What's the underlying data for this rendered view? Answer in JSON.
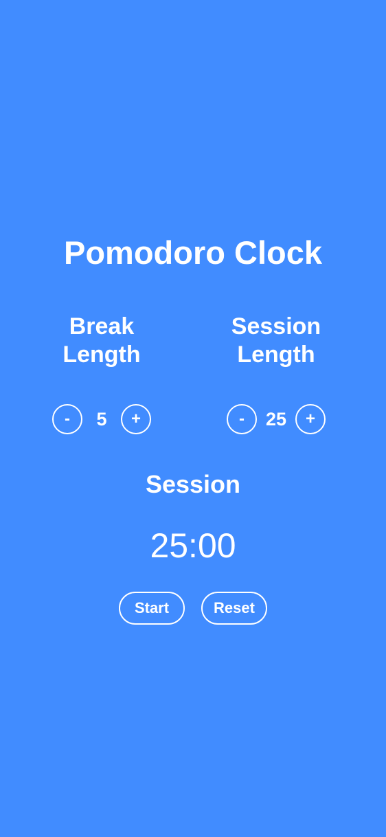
{
  "app": {
    "title": "Pomodoro Clock",
    "background_color": "#418cff",
    "text_color": "#ffffff"
  },
  "break": {
    "label_line1": "Break",
    "label_line2": "Length",
    "decrement_label": "-",
    "increment_label": "+",
    "value": "5"
  },
  "session": {
    "label_line1": "Session",
    "label_line2": "Length",
    "decrement_label": "-",
    "increment_label": "+",
    "value": "25"
  },
  "timer": {
    "label": "Session",
    "time": "25:00"
  },
  "actions": {
    "start_label": "Start",
    "reset_label": "Reset"
  }
}
